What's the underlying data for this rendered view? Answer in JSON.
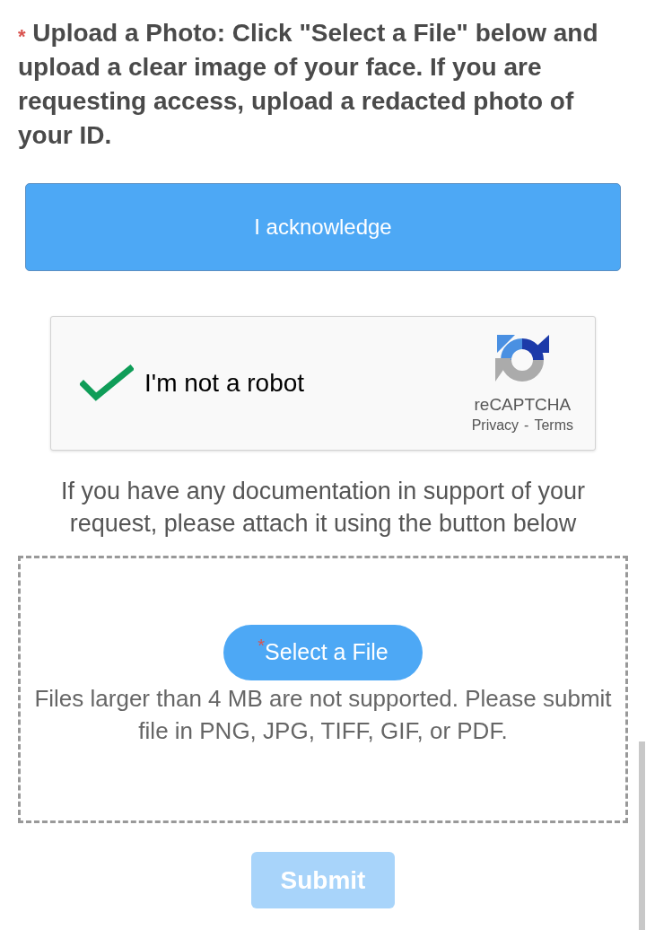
{
  "instruction": {
    "text": "$^{*}$ Upload a Photo: Click \"Select a File\" below and upload a clear image of your face. If you are requesting access, upload a redacted photo of your ID."
  },
  "acknowledge_button": {
    "label": "I acknowledge"
  },
  "recaptcha": {
    "checked": true,
    "label": "I'm not a robot",
    "brand": "reCAPTCHA",
    "links": [
      "Privacy",
      "Terms"
    ],
    "separator": "-"
  },
  "attachment_note": "If you have any documentation in support of your request, please attach it using the button below",
  "upload_area": {
    "select_button": {
      "required_mark": "*",
      "label": "Select a File"
    },
    "file_note": "Files larger than 4 MB are not supported. Please submit file in PNG, JPG, TIFF, GIF, or PDF."
  },
  "submit_button": {
    "label": "Submit",
    "disabled": true
  }
}
